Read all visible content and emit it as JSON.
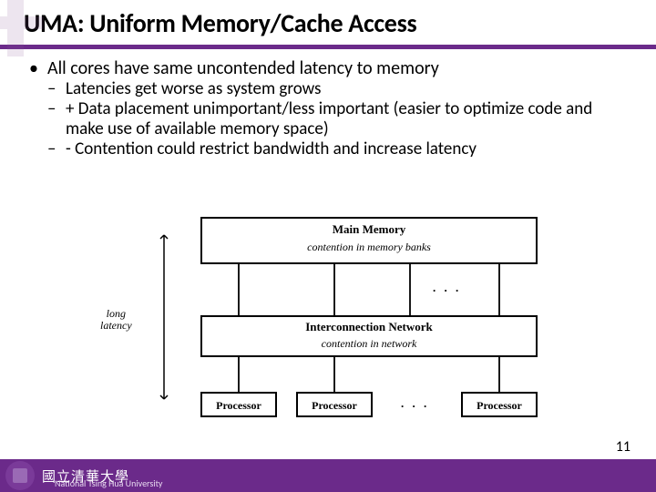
{
  "title": "UMA: Uniform Memory/Cache Access",
  "bullets": {
    "main": "All cores have same uncontended latency to memory",
    "sub1": "Latencies get worse as system grows",
    "sub2": "+ Data placement unimportant/less important (easier to optimize code and make use of available memory space)",
    "sub3": "- Contention could restrict bandwidth and increase latency"
  },
  "diagram": {
    "mainmem_title": "Main Memory",
    "mainmem_sub": "contention in memory banks",
    "interconn_title": "Interconnection Network",
    "interconn_sub": "contention in network",
    "processor": "Processor",
    "long_latency_l1": "long",
    "long_latency_l2": "latency",
    "dots": ". . ."
  },
  "footer": {
    "zh": "國立清華大學",
    "en": "National Tsing Hua University"
  },
  "page_number": "11"
}
